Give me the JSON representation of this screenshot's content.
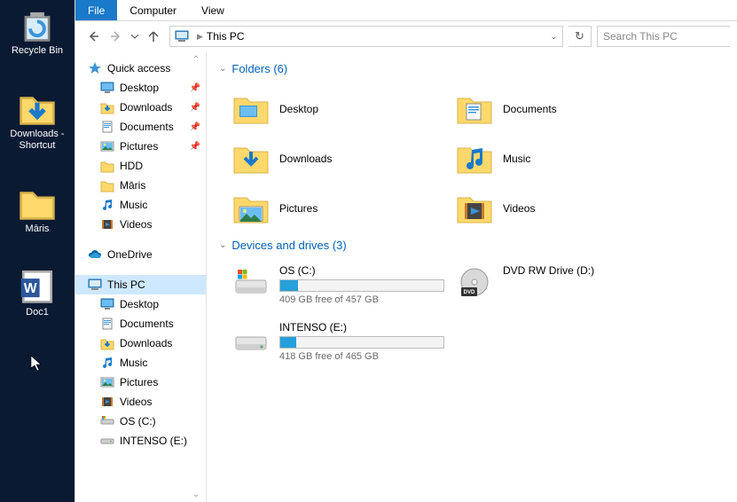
{
  "desktop": {
    "items": [
      {
        "label": "Recycle Bin",
        "icon": "recycle"
      },
      {
        "label": "Downloads - Shortcut",
        "icon": "dl-folder"
      },
      {
        "label": "Māris",
        "icon": "folder"
      },
      {
        "label": "Doc1",
        "icon": "word"
      }
    ]
  },
  "ribbon": {
    "file": "File",
    "computer": "Computer",
    "view": "View"
  },
  "address": {
    "location": "This PC"
  },
  "search": {
    "placeholder": "Search This PC"
  },
  "nav": {
    "quick": "Quick access",
    "quick_items": [
      {
        "label": "Desktop",
        "icon": "desktop",
        "pinned": true
      },
      {
        "label": "Downloads",
        "icon": "downloads",
        "pinned": true
      },
      {
        "label": "Documents",
        "icon": "documents",
        "pinned": true
      },
      {
        "label": "Pictures",
        "icon": "pictures",
        "pinned": true
      },
      {
        "label": "HDD",
        "icon": "folder",
        "pinned": false
      },
      {
        "label": "Māris",
        "icon": "folder",
        "pinned": false
      },
      {
        "label": "Music",
        "icon": "music",
        "pinned": false
      },
      {
        "label": "Videos",
        "icon": "videos",
        "pinned": false
      }
    ],
    "onedrive": "OneDrive",
    "thispc": "This PC",
    "thispc_items": [
      {
        "label": "Desktop",
        "icon": "desktop"
      },
      {
        "label": "Documents",
        "icon": "documents"
      },
      {
        "label": "Downloads",
        "icon": "downloads"
      },
      {
        "label": "Music",
        "icon": "music"
      },
      {
        "label": "Pictures",
        "icon": "pictures"
      },
      {
        "label": "Videos",
        "icon": "videos"
      },
      {
        "label": "OS (C:)",
        "icon": "drive-os"
      },
      {
        "label": "INTENSO (E:)",
        "icon": "drive"
      }
    ]
  },
  "content": {
    "folders_head": "Folders (6)",
    "folders": [
      {
        "label": "Desktop",
        "icon": "desktop-big"
      },
      {
        "label": "Documents",
        "icon": "documents-big"
      },
      {
        "label": "Downloads",
        "icon": "downloads-big"
      },
      {
        "label": "Music",
        "icon": "music-big"
      },
      {
        "label": "Pictures",
        "icon": "pictures-big"
      },
      {
        "label": "Videos",
        "icon": "videos-big"
      }
    ],
    "drives_head": "Devices and drives (3)",
    "drives": [
      {
        "label": "OS (C:)",
        "icon": "drive-os-big",
        "free": "409 GB free of 457 GB",
        "pct": 11
      },
      {
        "label": "DVD RW Drive (D:)",
        "icon": "dvd",
        "nobar": true
      },
      {
        "label": "INTENSO (E:)",
        "icon": "drive-big",
        "free": "418 GB free of 465 GB",
        "pct": 10
      }
    ]
  }
}
